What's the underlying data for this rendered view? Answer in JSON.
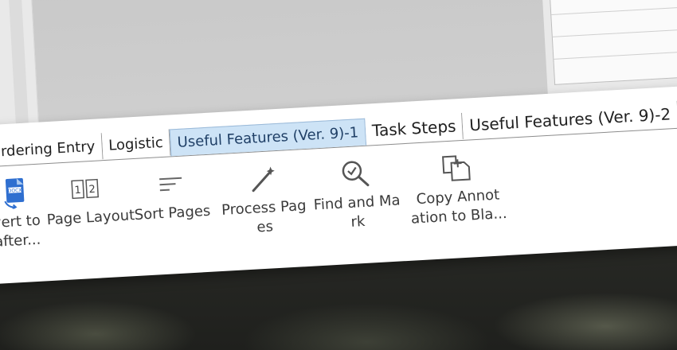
{
  "tabs": [
    {
      "label": "Ordering Entry"
    },
    {
      "label": "Logistic"
    },
    {
      "label": "Useful Features (Ver. 9)-1"
    },
    {
      "label": "Task Steps"
    },
    {
      "label": "Useful Features (Ver. 9)-2"
    },
    {
      "label": "Ta"
    }
  ],
  "active_tab_index": 2,
  "tools": [
    {
      "label": "vert to\nafter...",
      "icon": "convert-icon"
    },
    {
      "label": "Page Layout",
      "icon": "page-layout-icon"
    },
    {
      "label": "Sort Pages",
      "icon": "sort-icon"
    },
    {
      "label": "Process Pag\nes",
      "icon": "magic-wand-icon"
    },
    {
      "label": "Find and Ma\nrk",
      "icon": "magnifier-check-icon"
    },
    {
      "label": "Copy Annot\nation to Bla...",
      "icon": "copy-annotation-icon"
    }
  ],
  "colors": {
    "active_tab_bg": "#cde3f6",
    "convert_icon_blue": "#2f6fd0"
  }
}
